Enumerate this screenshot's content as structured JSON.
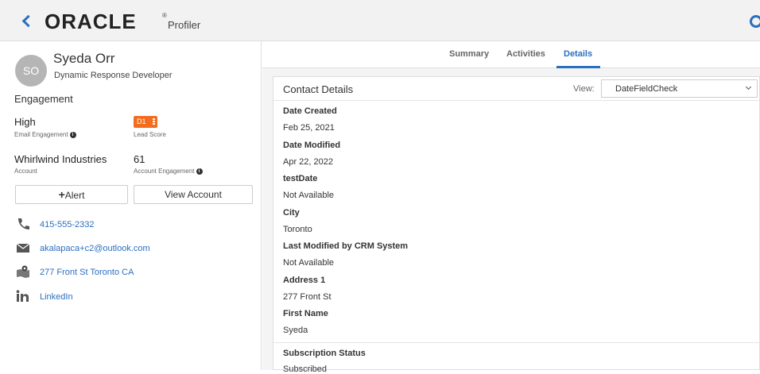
{
  "header": {
    "logo": "ORACLE",
    "reg": "®",
    "app_name": "Profiler"
  },
  "profile": {
    "initials": "SO",
    "name": "Syeda Orr",
    "title": "Dynamic Response Developer"
  },
  "engagement": {
    "section_label": "Engagement",
    "email_level": "High",
    "email_label": "Email Engagement",
    "lead_score": "D1",
    "lead_score_label": "Lead Score",
    "account_name": "Whirlwind Industries",
    "account_label": "Account",
    "account_engagement": "61",
    "account_engagement_label": "Account Engagement"
  },
  "actions": {
    "alert_label": "Alert",
    "view_account_label": "View Account"
  },
  "contact": {
    "phone": "415-555-2332",
    "email": "akalapaca+c2@outlook.com",
    "address": "277 Front St Toronto CA",
    "linkedin": "LinkedIn"
  },
  "tabs": [
    {
      "label": "Summary"
    },
    {
      "label": "Activities"
    },
    {
      "label": "Details"
    }
  ],
  "details": {
    "card_title": "Contact Details",
    "view_label": "View:",
    "view_selected": "DateFieldCheck",
    "fields": [
      {
        "label": "Date Created",
        "value": "Feb 25, 2021"
      },
      {
        "label": "Date Modified",
        "value": "Apr 22, 2022"
      },
      {
        "label": "testDate",
        "value": "Not Available"
      },
      {
        "label": "City",
        "value": "Toronto"
      },
      {
        "label": "Last Modified by CRM System",
        "value": "Not Available"
      },
      {
        "label": "Address 1",
        "value": "277 Front St"
      },
      {
        "label": "First Name",
        "value": "Syeda"
      },
      {
        "label": "Subscription Status",
        "value": "Subscribed"
      }
    ]
  },
  "colors": {
    "accent": "#2a6fc0",
    "badge": "#f26d1f"
  }
}
